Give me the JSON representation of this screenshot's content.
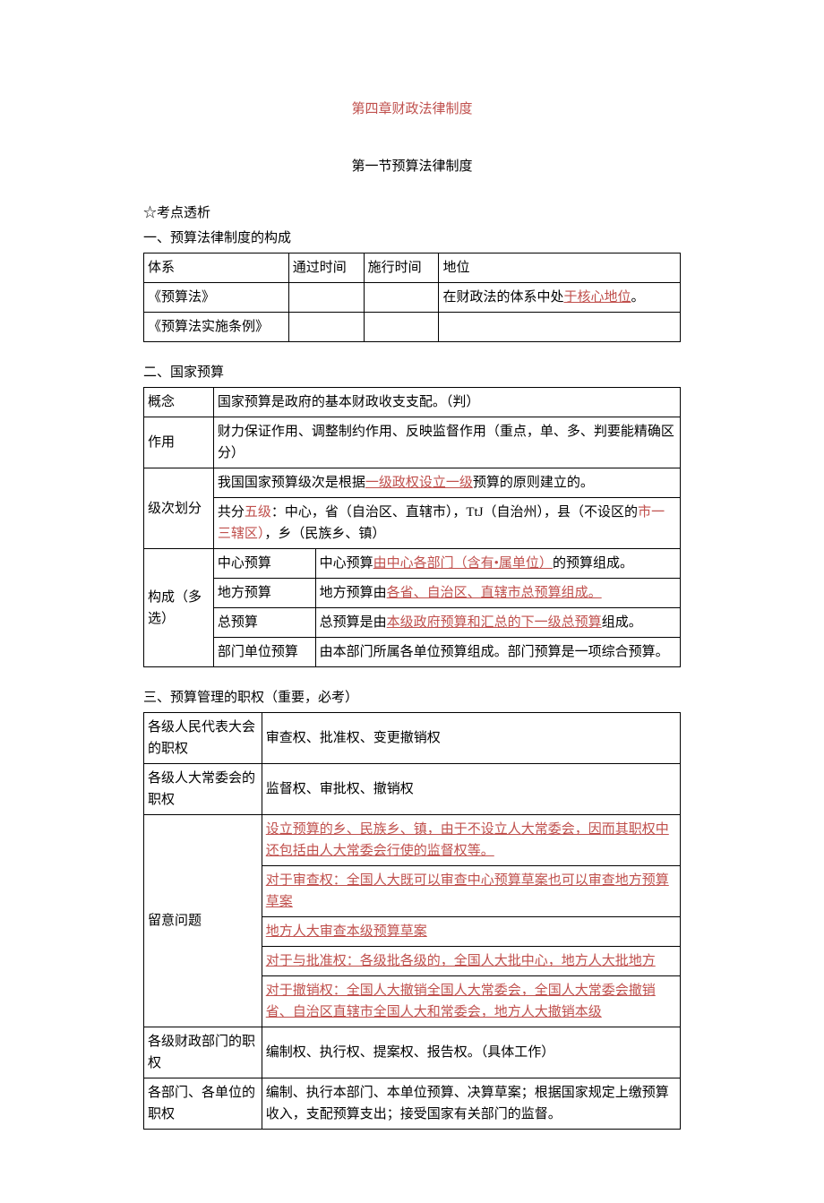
{
  "title_main": "第四章财政法律制度",
  "title_section": "第一节预算法律制度",
  "lead1": "☆考点透析",
  "lead2": "一、预算法律制度的构成",
  "table1": {
    "h1": "体系",
    "h2": "通过时间",
    "h3": "施行时间",
    "h4": "地位",
    "r1c1": "《预算法》",
    "r1c4_a": "在财政法的体系中处",
    "r1c4_b": "于核心地位",
    "r1c4_c": "。",
    "r2c1": "《预算法实施条例》"
  },
  "lead3": "二、国家预算",
  "table2": {
    "r1c1": "概念",
    "r1c2": "国家预算是政府的基本财政收支支配。（判）",
    "r2c1": "作用",
    "r2c2": "财力保证作用、调整制约作用、反映监督作用（重点，单、多、判要能精确区分）",
    "r3c1": "级次划分",
    "r3a_a": "我国国家预算级次是根据",
    "r3a_b": "一级政权设立一级",
    "r3a_c": "预算的原则建立的。",
    "r3b_a": "共分",
    "r3b_b": "五级",
    "r3b_c": "：中心，省（自治区、直辖市），TtJ（自治州），县（不设区的",
    "r3b_d": "市一三辖区）",
    "r3b_e": "，乡（民族乡、镇）",
    "r4c1": "构成（多选）",
    "r4a1": "中心预算",
    "r4a2_a": "中心预算",
    "r4a2_b": "由中心各部门（含有•属单位）",
    "r4a2_c": "的预算组成。",
    "r4b1": "地方预算",
    "r4b2_a": "地方预算由",
    "r4b2_b": "各省、自治区、直辖市总预算组成。",
    "r4c1b": "总预算",
    "r4c2_a": "总预算是由",
    "r4c2_b": "本级政府预算和汇总的下一级总预算",
    "r4c2_c": "组成。",
    "r4d1": "部门单位预算",
    "r4d2": "由本部门所属各单位预算组成。部门预算是一项综合预算。"
  },
  "lead4": "三、预算管理的职权（重要，必考）",
  "table3": {
    "r1c1": "各级人民代表大会的职权",
    "r1c2": "审查权、批准权、变更撤销权",
    "r2c1": "各级人大常委会的职权",
    "r2c2": "监督权、审批权、撤销权",
    "r3c1": "留意问题",
    "r3a": "设立预算的乡、民族乡、镇，由于不设立人大常委会，因而其职权中还包括由人大常委会行使的监督权等。",
    "r3b": "对于审查权：全国人大既可以审查中心预算草案也可以审查地方预算草案",
    "r3c": "地方人大审查本级预算草案",
    "r3d": "对于与批准权：各级批各级的，全国人大批中心，地方人大批地方",
    "r3e": "对于撤销权：全国人大撤销全国人大常委会，全国人大常委会撤销省、自治区直辖市全国人大和常委会，地方人大撤销本级",
    "r4c1": "各级财政部门的职权",
    "r4c2": "编制权、执行权、提案权、报告权。（具体工作）",
    "r5c1": "各部门、各单位的职权",
    "r5c2": "编制、执行本部门、本单位预算、决算草案；根据国家规定上缴预算收入，支配预算支出；接受国家有关部门的监督。"
  }
}
